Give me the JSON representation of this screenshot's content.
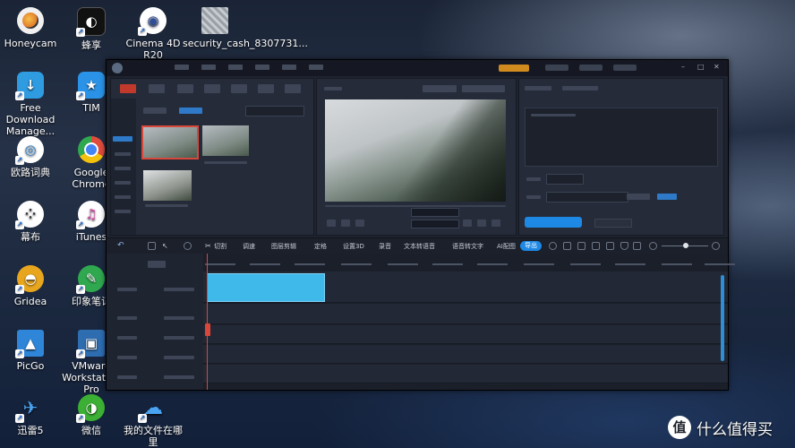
{
  "desktop": {
    "icons": [
      {
        "id": "honeycam",
        "label": "Honeycam",
        "color": "#e6a03a"
      },
      {
        "id": "fengxiang",
        "label": "蜂享",
        "color": "#ffffff"
      },
      {
        "id": "cinema4d",
        "label": "Cinema 4D R20",
        "color": "#3b5ba8"
      },
      {
        "id": "security",
        "label": "security_cash_8307731...",
        "color": "#777b80"
      },
      {
        "id": "freedownload",
        "label": "Free Download Manage...",
        "color": "#2f9be0"
      },
      {
        "id": "tim",
        "label": "TIM",
        "color": "#2a93e8"
      },
      {
        "id": "youdao",
        "label": "欧路词典",
        "color": "#2f85d6"
      },
      {
        "id": "chrome",
        "label": "Google Chrome",
        "color": "#e04b3c"
      },
      {
        "id": "mubu",
        "label": "幕布",
        "color": "#f2f2f2"
      },
      {
        "id": "itunes",
        "label": "iTunes",
        "color": "#e0e6f5"
      },
      {
        "id": "gridea",
        "label": "Gridea",
        "color": "#e8a61f"
      },
      {
        "id": "yinxiang",
        "label": "印象笔记",
        "color": "#2fa84f"
      },
      {
        "id": "picgo",
        "label": "PicGo",
        "color": "#2f86d9"
      },
      {
        "id": "vmware",
        "label": "VMware Workstation Pro",
        "color": "#2e6db0"
      },
      {
        "id": "xunlei",
        "label": "迅雷5",
        "color": "#2c7ed2"
      },
      {
        "id": "weixin",
        "label": "微信",
        "color": "#3cb034"
      },
      {
        "id": "mydocs",
        "label": "我的文件在哪里",
        "color": "#2f80d6"
      }
    ]
  },
  "watermark": {
    "glyph": "值",
    "text": "什么值得买"
  },
  "editor": {
    "timeline_toolbar": {
      "items": [
        "切割",
        "调速",
        "图层剪辑",
        "定格",
        "设置3D",
        "录音",
        "文本转语音",
        "语音转文字",
        "AI配图"
      ],
      "export_label": "导出"
    }
  }
}
